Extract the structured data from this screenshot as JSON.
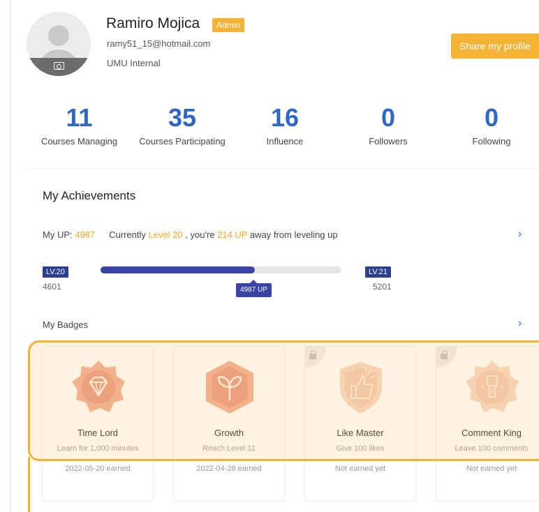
{
  "profile": {
    "name": "Ramiro Mojica",
    "role_badge": "Admin",
    "email": "ramy51_15@hotmail.com",
    "organization": "UMU Internal",
    "share_label": "Share my profile"
  },
  "stats": [
    {
      "value": "11",
      "label": "Courses Managing"
    },
    {
      "value": "35",
      "label": "Courses Participating"
    },
    {
      "value": "16",
      "label": "Influence"
    },
    {
      "value": "0",
      "label": "Followers"
    },
    {
      "value": "0",
      "label": "Following"
    }
  ],
  "achievements": {
    "title": "My Achievements",
    "up_prefix": "My UP: ",
    "up_value": "4987",
    "level_text_1": "Currently ",
    "current_level": "Level 20",
    "level_text_2": " , you're ",
    "up_away": "214 UP",
    "level_text_3": " away from leveling up",
    "current_lv_tag": "LV.20",
    "current_lv_points": "4601",
    "next_lv_tag": "LV.21",
    "next_lv_points": "5201",
    "progress_tip": "4987 UP",
    "progress_fraction": 0.64,
    "chevron": "›"
  },
  "badges": {
    "title": "My Badges",
    "chevron": "›",
    "items": [
      {
        "name": "Time Lord",
        "desc": "Learn for 1,000 minutes",
        "status": "2022-05-20 earned",
        "icon": "diamond-icon"
      },
      {
        "name": "Growth",
        "desc": "Reach Level 11",
        "status": "2022-04-28 earned",
        "icon": "sprout-icon"
      },
      {
        "name": "Like Master",
        "desc": "Give 100 likes",
        "status": "Not earned yet",
        "icon": "thumbs-up-icon"
      },
      {
        "name": "Comment King",
        "desc": "Leave 100 comments",
        "status": "Not earned yet",
        "icon": "microphone-icon"
      }
    ]
  },
  "colors": {
    "accent_blue": "#2f67c9",
    "accent_orange": "#f5b335",
    "level_navy": "#2c3e8f"
  }
}
